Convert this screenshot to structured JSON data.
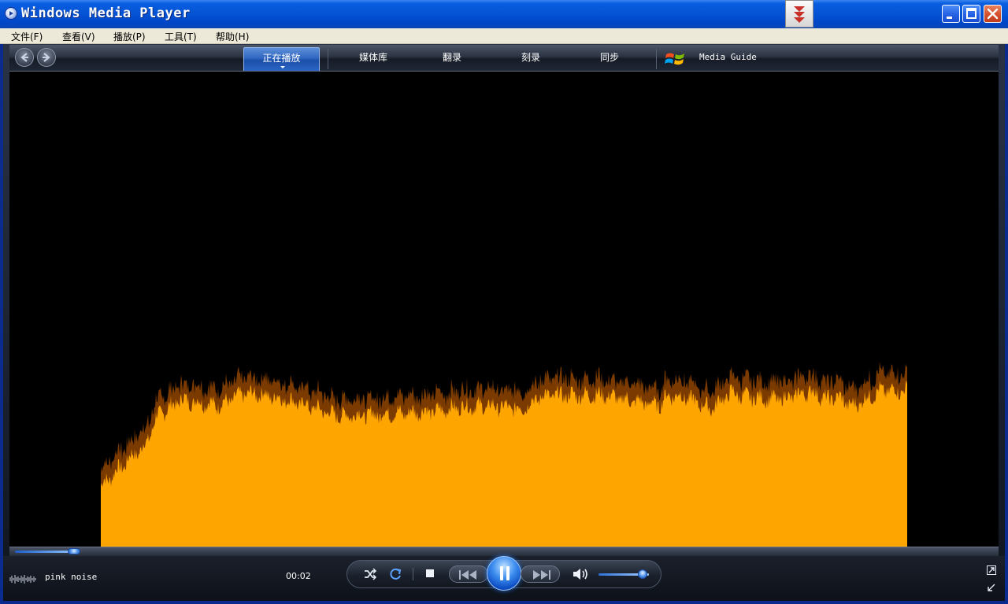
{
  "window": {
    "title": "Windows Media Player"
  },
  "menu": {
    "items": [
      {
        "label": "文件(F)"
      },
      {
        "label": "查看(V)"
      },
      {
        "label": "播放(P)"
      },
      {
        "label": "工具(T)"
      },
      {
        "label": "帮助(H)"
      }
    ]
  },
  "tabs": [
    {
      "label": "正在播放",
      "active": true
    },
    {
      "label": "媒体库",
      "active": false
    },
    {
      "label": "翻录",
      "active": false
    },
    {
      "label": "刻录",
      "active": false
    },
    {
      "label": "同步",
      "active": false
    }
  ],
  "media_guide": {
    "label": "Media Guide"
  },
  "player": {
    "track_title": "pink noise",
    "elapsed": "00:02",
    "seek_fraction": 0.06,
    "volume_fraction": 0.88,
    "state": "playing"
  },
  "icons": {
    "back": "back-arrow-icon",
    "forward": "forward-arrow-icon",
    "shuffle": "shuffle-icon",
    "repeat": "repeat-icon",
    "stop": "stop-icon",
    "previous": "previous-icon",
    "pause": "pause-icon",
    "next": "next-icon",
    "volume": "speaker-icon",
    "compact_mode": "switch-to-compact-icon",
    "full_screen": "full-screen-icon",
    "mini_player": "mini-player-icon"
  },
  "colors": {
    "visualization_fill": "#FFA500",
    "visualization_shade": "#7A3A00",
    "title_bar": "#0054E3",
    "accent_blue": "#3D8EF0",
    "close_button": "#D5502C"
  }
}
